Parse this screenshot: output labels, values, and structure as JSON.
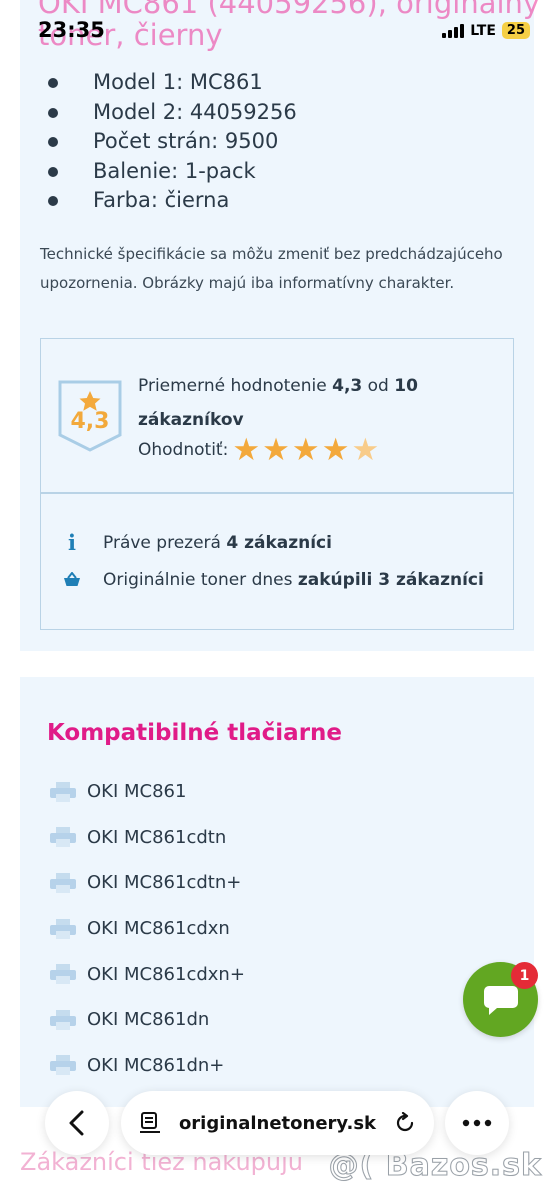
{
  "status_bar": {
    "time": "23:35",
    "network": "LTE",
    "battery": "25"
  },
  "header_peek": {
    "title_line1": "OKI MC861 (44059256), originálny",
    "title_line2": "toner, čierny"
  },
  "specs": [
    "Model 1: MC861",
    "Model 2: 44059256",
    "Počet strán: 9500",
    "Balenie: 1-pack",
    "Farba: čierna"
  ],
  "disclaimer": "Technické špecifikácie sa môžu zmeniť bez predchádzajúceho upozornenia. Obrázky majú iba informatívny charakter.",
  "rating": {
    "badge_value": "4,3",
    "avg_prefix": "Priemerné hodnotenie ",
    "avg_value": "4,3",
    "avg_middle": " od ",
    "count": "10",
    "count_suffix": "zákazníkov",
    "rate_label": "Ohodnotiť:",
    "stars_full": 4,
    "stars_total": 5,
    "star_color": "#f3a93c"
  },
  "activity": {
    "viewing_prefix": "Práve prezerá ",
    "viewing_bold": "4 zákazníci",
    "bought_prefix": "Originálnie toner dnes ",
    "bought_bold": "zakúpili 3 zákazníci"
  },
  "compatible": {
    "title": "Kompatibilné tlačiarne",
    "printers": [
      "OKI MC861",
      "OKI MC861cdtn",
      "OKI MC861cdtn+",
      "OKI MC861cdxn",
      "OKI MC861cdxn+",
      "OKI MC861dn",
      "OKI MC861dn+"
    ]
  },
  "footer_peek": "Zákazníci tiež nakupujú",
  "watermark": "@( Bazos.sk",
  "chat": {
    "unread": "1",
    "color": "#62a722"
  },
  "browser": {
    "url": "originalnetonery.sk"
  },
  "colors": {
    "accent_pink": "#e01b88",
    "card_bg": "#eef6fd",
    "info_blue": "#1f7fb6"
  }
}
